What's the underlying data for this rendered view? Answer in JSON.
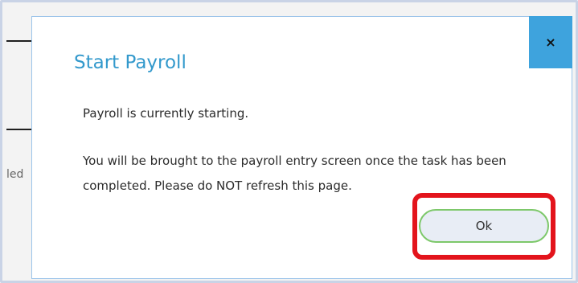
{
  "background": {
    "fragment_text": "led"
  },
  "dialog": {
    "title": "Start Payroll",
    "close_label": "×",
    "message_line1": "Payroll is currently starting.",
    "message_line2": "You will be brought to the payroll entry screen once the task has been completed. Please do NOT refresh this page.",
    "ok_label": "Ok"
  },
  "colors": {
    "title": "#3399cc",
    "close_bg": "#3ea3dd",
    "ok_border": "#7dc86a",
    "ok_bg": "#e8edf5",
    "highlight": "#e3141c"
  }
}
